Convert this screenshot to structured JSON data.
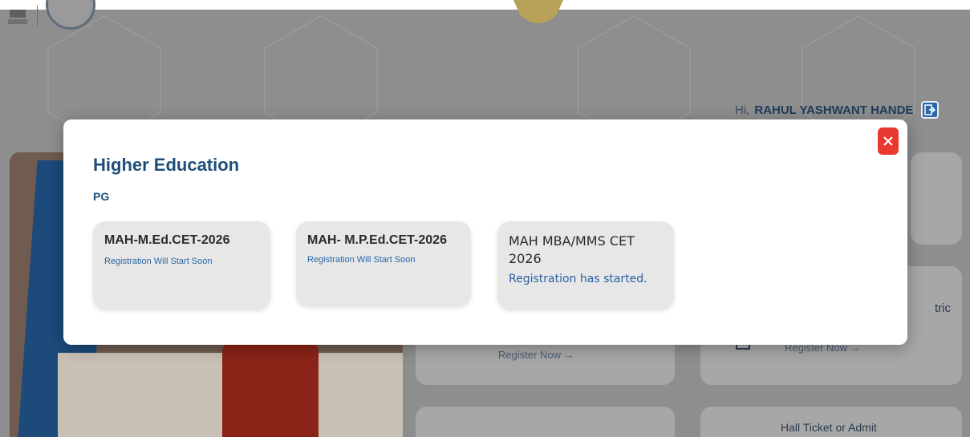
{
  "header": {
    "greeting_prefix": "Hi,",
    "user_name": "RAHUL YASHWANT HANDE"
  },
  "background": {
    "cards": [
      {
        "text": "Register Now →"
      },
      {
        "text": "Register Now →"
      },
      {
        "text": "tric"
      },
      {
        "text": "Hall Ticket or Admit"
      }
    ]
  },
  "modal": {
    "title": "Higher Education",
    "subtitle": "PG",
    "courses": [
      {
        "name": "MAH-M.Ed.CET-2026",
        "status": "Registration Will Start Soon"
      },
      {
        "name": "MAH- M.P.Ed.CET-2026",
        "status": "Registration Will Start Soon"
      },
      {
        "name": "MAH MBA/MMS CET 2026",
        "status": "Registration has started."
      }
    ]
  },
  "colors": {
    "accent": "#1f4e79",
    "close": "#e8382f",
    "link": "#2a66a8"
  },
  "icons": [
    "logout-icon",
    "close-icon",
    "emblem-icon",
    "seal-icon"
  ]
}
